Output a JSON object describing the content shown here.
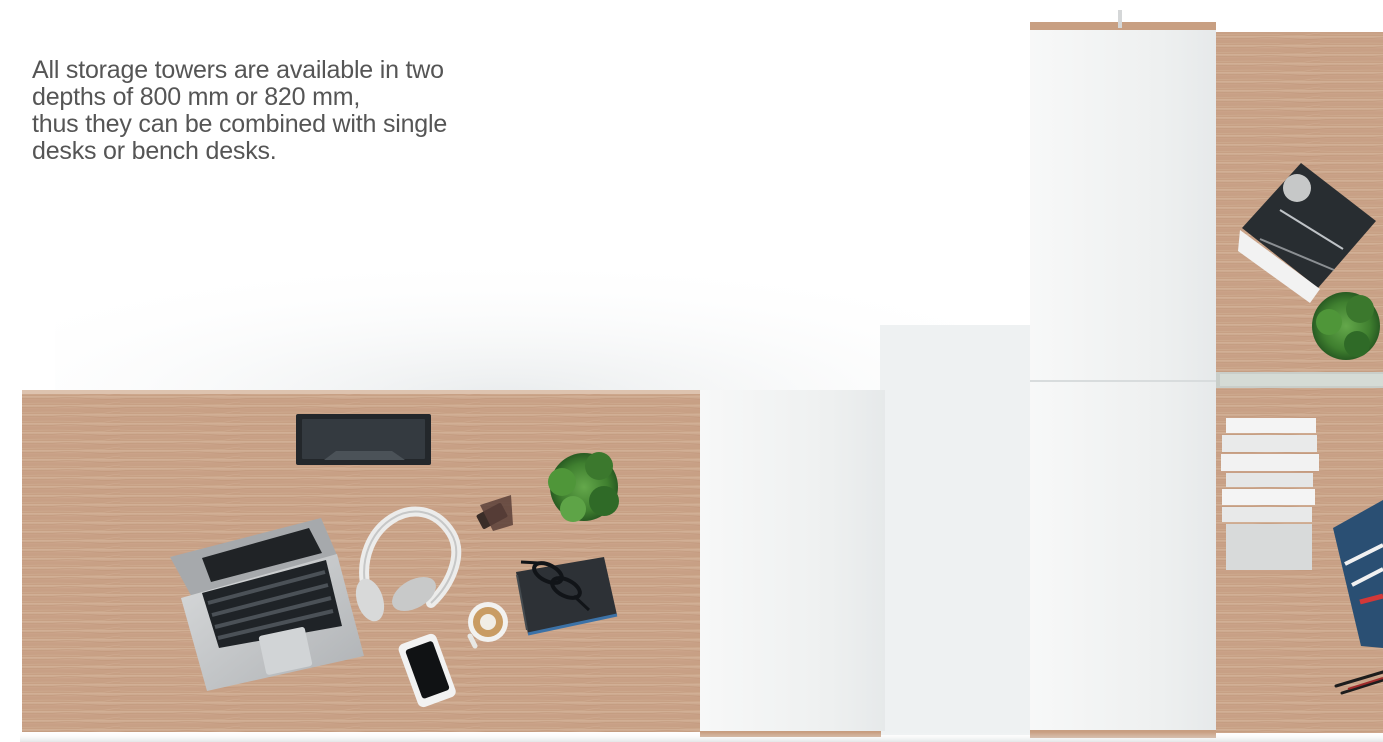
{
  "description": {
    "lines": [
      "All storage towers are available in two",
      "depths of 800 mm or 820 mm,",
      "thus they can be combined with single",
      "desks or bench desks."
    ]
  },
  "colors": {
    "background": "#ffffff",
    "text": "#555555",
    "desk_wood": "#caa58b",
    "storage_white": "#f0f1f1",
    "plant_green": "#3f7f2f",
    "laptop_silver": "#bfc1c3",
    "notebook_dark": "#2d3136",
    "accent_blue": "#3c72a7"
  },
  "scene_objects": [
    "desk",
    "storage-tower",
    "laptop",
    "headphones",
    "plant",
    "notebook",
    "coffee-cup",
    "smartphone",
    "book-stack",
    "magazine"
  ]
}
